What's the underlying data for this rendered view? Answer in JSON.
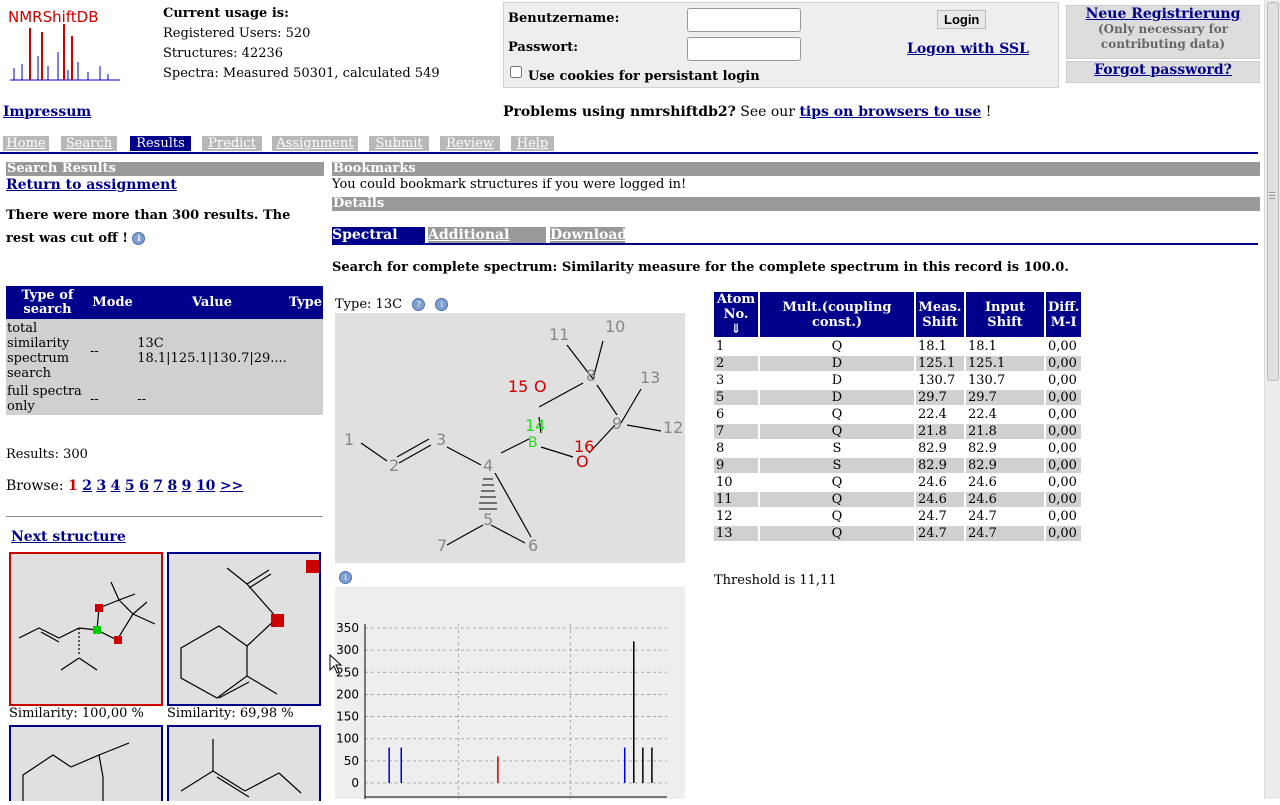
{
  "header": {
    "logo_text": "NMRShiftDB",
    "usage_title": "Current usage is:",
    "registered": "Registered Users: 520",
    "structures": "Structures: 42236",
    "spectra": "Spectra: Measured 50301, calculated 549",
    "impressum": "Impressum"
  },
  "login": {
    "username_label": "Benutzername:",
    "password_label": "Passwort:",
    "login_button": "Login",
    "ssl_link": "Logon with SSL",
    "cookie_label": "Use cookies for persistant login",
    "register": "Neue Registrierung",
    "register_sub": "(Only necessary for contributing data)",
    "forgot": "Forgot password?",
    "problems_prefix": "Problems using nmrshiftdb2?",
    "problems_mid": " See our ",
    "problems_link": "tips on browsers to use",
    "problems_suffix": " !"
  },
  "nav": {
    "tabs": [
      "Home",
      "Search",
      "Results",
      "Predict",
      "Assignment",
      "Submit",
      "Review",
      "Help"
    ]
  },
  "left": {
    "section_title": "Search Results",
    "return_link": "Return to assignment",
    "warning": "There were more than 300 results. The rest was cut off !",
    "table_headers": [
      "Type of search",
      "Mode",
      "Value",
      "Type"
    ],
    "rows": [
      {
        "type": "total similarity spectrum search",
        "mode": "--",
        "value": "13C 18.1|125.1|130.7|29....",
        "kind": ""
      },
      {
        "type": "full spectra only",
        "mode": "--",
        "value": "--",
        "kind": ""
      }
    ],
    "results_count": "Results: 300",
    "browse_label": "Browse:",
    "pages": [
      "1",
      "2",
      "3",
      "4",
      "5",
      "6",
      "7",
      "8",
      "9",
      "10",
      ">>"
    ],
    "next_structure": "Next structure",
    "similarities": [
      "Similarity: 100,00 %",
      "Similarity: 69,98 %"
    ]
  },
  "right": {
    "bookmarks_title": "Bookmarks",
    "bookmarks_text": "You could bookmark structures if you were logged in!",
    "details_title": "Details",
    "subtabs": [
      "Spectral Data",
      "Additional Data",
      "Download"
    ],
    "similarity_text": "Search for complete spectrum: Similarity measure for the complete spectrum in this record is 100.0.",
    "type_label": "Type: 13C",
    "atom_labels": [
      "1",
      "2",
      "3",
      "4",
      "5",
      "6",
      "7",
      "8",
      "9",
      "10",
      "11",
      "12",
      "13",
      "14",
      "15",
      "16"
    ],
    "atom_symbols": {
      "b": "B",
      "o15": "O",
      "o16": "O"
    },
    "table_headers": [
      "Atom No. ⇓",
      "Mult.(coupling const.)",
      "Meas. Shift",
      "Input Shift",
      "Diff. M-I"
    ],
    "shift_rows": [
      [
        "1",
        "Q",
        "18.1",
        "18.1",
        "0,00"
      ],
      [
        "2",
        "D",
        "125.1",
        "125.1",
        "0,00"
      ],
      [
        "3",
        "D",
        "130.7",
        "130.7",
        "0,00"
      ],
      [
        "5",
        "D",
        "29.7",
        "29.7",
        "0,00"
      ],
      [
        "6",
        "Q",
        "22.4",
        "22.4",
        "0,00"
      ],
      [
        "7",
        "Q",
        "21.8",
        "21.8",
        "0,00"
      ],
      [
        "8",
        "S",
        "82.9",
        "82.9",
        "0,00"
      ],
      [
        "9",
        "S",
        "82.9",
        "82.9",
        "0,00"
      ],
      [
        "10",
        "Q",
        "24.6",
        "24.6",
        "0,00"
      ],
      [
        "11",
        "Q",
        "24.6",
        "24.6",
        "0,00"
      ],
      [
        "12",
        "Q",
        "24.7",
        "24.7",
        "0,00"
      ],
      [
        "13",
        "Q",
        "24.7",
        "24.7",
        "0,00"
      ]
    ],
    "threshold": "Threshold is 11,11"
  },
  "chart_data": {
    "type": "bar",
    "title": "",
    "ylim": [
      0,
      350
    ],
    "yticks": [
      "350",
      "300",
      "250",
      "200",
      "150",
      "100",
      "50",
      "0"
    ],
    "series": [
      {
        "color": "#0000cc",
        "x": [
          0.08,
          0.12,
          0.86
        ],
        "values": [
          80,
          80,
          80
        ]
      },
      {
        "color": "#cc0000",
        "x": [
          0.44
        ],
        "values": [
          60
        ]
      },
      {
        "color": "#000000",
        "x": [
          0.89,
          0.92,
          0.95
        ],
        "values": [
          320,
          80,
          80
        ]
      }
    ]
  },
  "colors": {
    "brand": "#00008b",
    "tab_inactive": "#b8b8b8",
    "section": "#999999",
    "red": "#cc0000",
    "green": "#00cc00"
  }
}
